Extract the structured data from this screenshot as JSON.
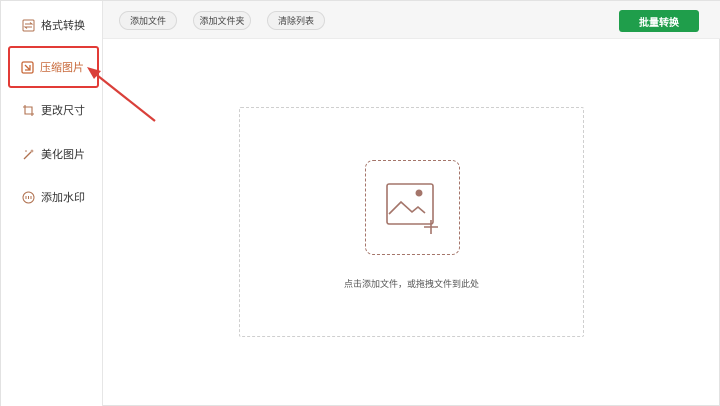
{
  "sidebar": {
    "items": [
      {
        "label": "格式转换",
        "icon": "format-convert-icon"
      },
      {
        "label": "压缩图片",
        "icon": "compress-image-icon",
        "active": true
      },
      {
        "label": "更改尺寸",
        "icon": "crop-icon"
      },
      {
        "label": "美化图片",
        "icon": "magic-wand-icon"
      },
      {
        "label": "添加水印",
        "icon": "watermark-icon"
      }
    ]
  },
  "toolbar": {
    "add_file": "添加文件",
    "add_folder": "添加文件夹",
    "clear_list": "清除列表",
    "batch_convert": "批量转换"
  },
  "dropzone": {
    "hint": "点击添加文件，或拖拽文件到此处",
    "icon": "add-image-icon"
  },
  "colors": {
    "accent": "#c8693a",
    "highlight": "#e23b36",
    "primary": "#1f9e4b",
    "icon_brown": "#a4756a"
  }
}
